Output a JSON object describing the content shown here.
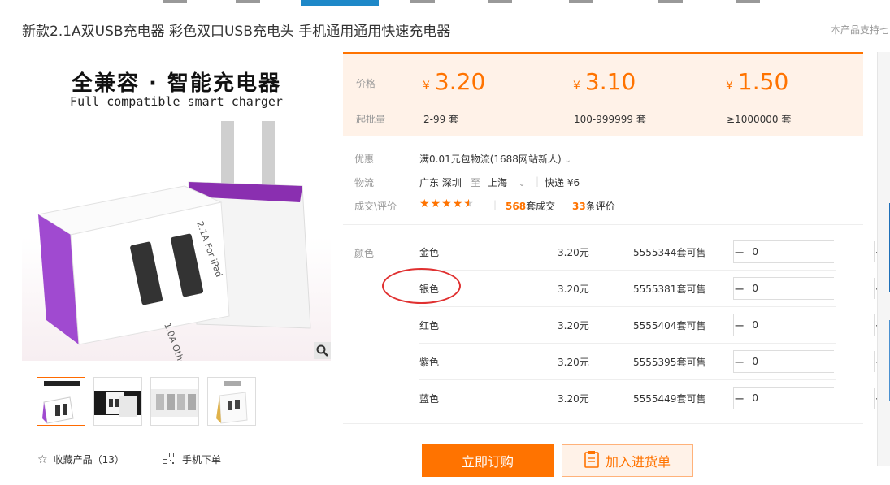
{
  "product": {
    "title": "新款2.1A双USB充电器 彩色双口USB充电头 手机通用通用快速充电器",
    "support_text": "本产品支持七",
    "image_headline": "全兼容 · 智能充电器",
    "image_subline": "Full compatible smart charger"
  },
  "price_box": {
    "price_label": "价格",
    "qty_label": "起批量",
    "currency": "¥",
    "tiers": [
      {
        "price": "3.20",
        "qty": "2-99 套"
      },
      {
        "price": "3.10",
        "qty": "100-999999 套"
      },
      {
        "price": "1.50",
        "qty": "≥1000000 套"
      }
    ]
  },
  "info": {
    "promo_label": "优惠",
    "promo_text": "满0.01元包物流(1688网站新人)",
    "logistics_label": "物流",
    "origin": "广东 深圳",
    "to_word": "至",
    "destination": "上海",
    "shipping": "快递 ¥6",
    "deal_label": "成交\\评价",
    "rating_stars": 4.5,
    "deals_count": "568",
    "deals_suffix": "套成交",
    "reviews_count": "33",
    "reviews_suffix": "条评价"
  },
  "sku": {
    "label": "颜色",
    "rows": [
      {
        "name": "金色",
        "price": "3.20元",
        "stock": "5555344套可售",
        "qty": "0"
      },
      {
        "name": "银色",
        "price": "3.20元",
        "stock": "5555381套可售",
        "qty": "0"
      },
      {
        "name": "红色",
        "price": "3.20元",
        "stock": "5555404套可售",
        "qty": "0"
      },
      {
        "name": "紫色",
        "price": "3.20元",
        "stock": "5555395套可售",
        "qty": "0"
      },
      {
        "name": "蓝色",
        "price": "3.20元",
        "stock": "5555449套可售",
        "qty": "0"
      }
    ]
  },
  "actions": {
    "order": "立即订购",
    "add_cart": "加入进货单",
    "favorite": "收藏产品（13）",
    "mobile_order": "手机下单"
  },
  "colors": {
    "accent": "#ff7300",
    "price_bg": "#fff2e8",
    "annotation": "#e03030",
    "nav_blue": "#1e88c8"
  }
}
